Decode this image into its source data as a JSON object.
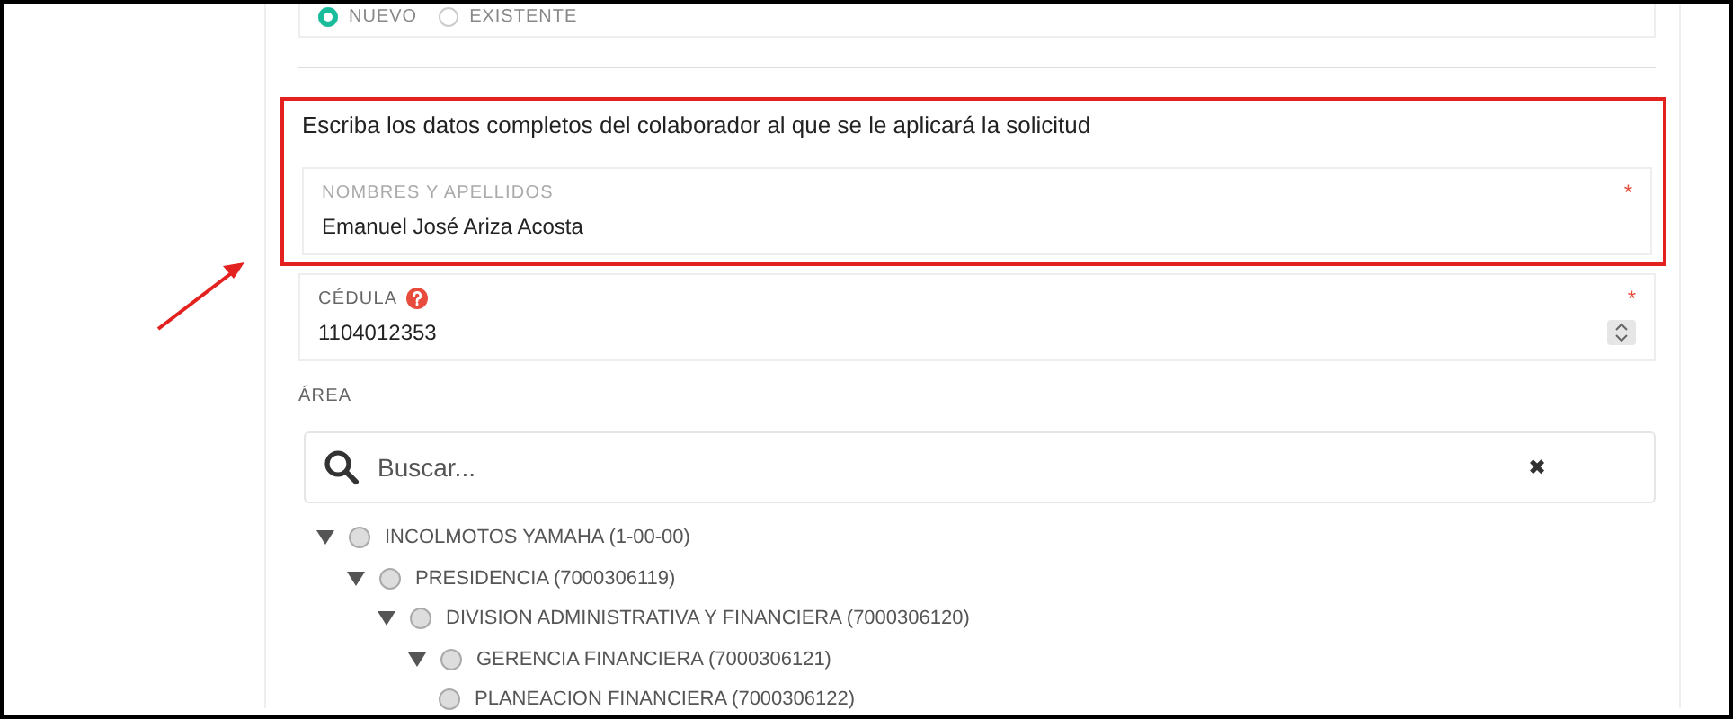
{
  "client_type": {
    "options": [
      {
        "label": "NUEVO",
        "selected": true
      },
      {
        "label": "EXISTENTE",
        "selected": false
      }
    ]
  },
  "collaborator": {
    "instruction": "Escriba los datos completos del colaborador al que se le aplicará la solicitud",
    "highlighted": true,
    "name_field": {
      "label": "NOMBRES Y APELLIDOS",
      "value": "Emanuel José Ariza Acosta",
      "required_mark": "*"
    }
  },
  "id_field": {
    "label": "CÉDULA",
    "value": "1104012353",
    "required_mark": "*"
  },
  "area": {
    "label": "ÁREA",
    "search": {
      "placeholder": "Buscar...",
      "clear": "✖"
    },
    "tree": [
      {
        "label": "INCOLMOTOS YAMAHA (1-00-00)",
        "expanded": true,
        "checked": false,
        "children": [
          {
            "label": "PRESIDENCIA (7000306119)",
            "expanded": true,
            "checked": false,
            "children": [
              {
                "label": "DIVISION ADMINISTRATIVA Y FINANCIERA (7000306120)",
                "expanded": true,
                "checked": false,
                "children": [
                  {
                    "label": "GERENCIA FINANCIERA (7000306121)",
                    "expanded": true,
                    "checked": false,
                    "children": [
                      {
                        "label": "PLANEACION FINANCIERA (7000306122)",
                        "checked": false
                      }
                    ]
                  }
                ]
              }
            ]
          }
        ]
      }
    ]
  }
}
